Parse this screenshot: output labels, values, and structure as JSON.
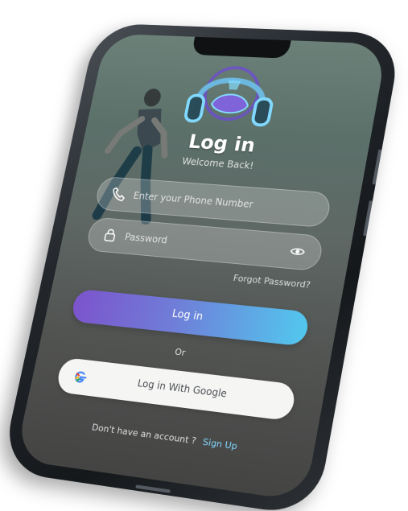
{
  "screen": {
    "title": "Log in",
    "subtitle": "Welcome Back!",
    "phone_placeholder": "Enter your Phone Number",
    "password_placeholder": "Password",
    "forgot_password": "Forgot Password?",
    "login_button": "Log in",
    "or_text": "Or",
    "google_button": "Log in With Google",
    "signup_prompt": "Don't have an account ?",
    "signup_link": "Sign Up"
  },
  "icons": {
    "logo": "headphone-logo",
    "runner": "runner-image",
    "phone": "phone-icon",
    "lock": "lock-icon",
    "eye": "eye-icon",
    "google": "google-icon"
  },
  "colors": {
    "gradient_start": "#7c54cc",
    "gradient_end": "#52c7ee",
    "accent": "#82d9ff"
  }
}
